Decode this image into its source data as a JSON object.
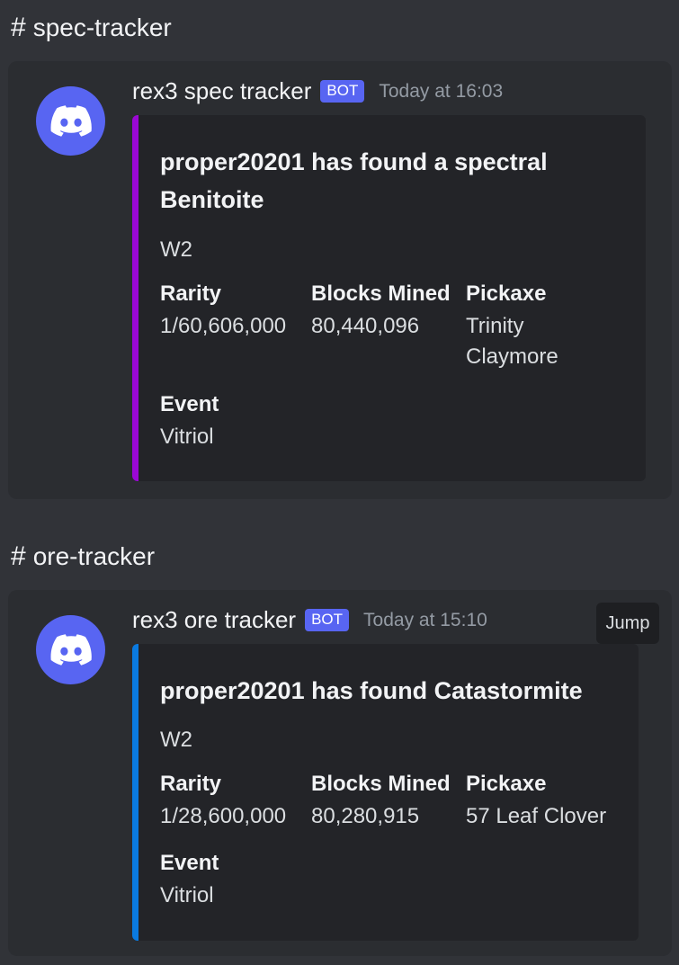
{
  "channels": [
    {
      "name": "spec-tracker",
      "message": {
        "author": "rex3 spec tracker",
        "badge": "BOT",
        "timestamp": "Today at 16:03",
        "embed_color": "#9b08d4",
        "embed": {
          "title_player": "proper20201",
          "title_middle": " has found a spectral ",
          "title_item": "Benitoite",
          "description": "W2",
          "fields": [
            {
              "name": "Rarity",
              "value": "1/60,606,000"
            },
            {
              "name": "Blocks Mined",
              "value": "80,440,096"
            },
            {
              "name": "Pickaxe",
              "value": "Trinity Claymore"
            },
            {
              "name": "Event",
              "value": "Vitriol"
            }
          ]
        }
      }
    },
    {
      "name": "ore-tracker",
      "message": {
        "author": "rex3 ore tracker",
        "badge": "BOT",
        "timestamp": "Today at 15:10",
        "jump_label": "Jump",
        "embed_color": "#0a7ae0",
        "embed": {
          "title_player": "proper20201",
          "title_middle": " has found ",
          "title_item": "Catastormite",
          "description": "W2",
          "fields": [
            {
              "name": "Rarity",
              "value": "1/28,600,000"
            },
            {
              "name": "Blocks Mined",
              "value": "80,280,915"
            },
            {
              "name": "Pickaxe",
              "value": "57 Leaf Clover"
            },
            {
              "name": "Event",
              "value": "Vitriol"
            }
          ]
        }
      }
    }
  ],
  "icons": {
    "hash": "hash-icon",
    "avatar": "discord-logo-icon"
  },
  "colors": {
    "background": "#313338",
    "card": "#2b2d31",
    "embed": "#232428",
    "bot_badge": "#5865f2"
  }
}
